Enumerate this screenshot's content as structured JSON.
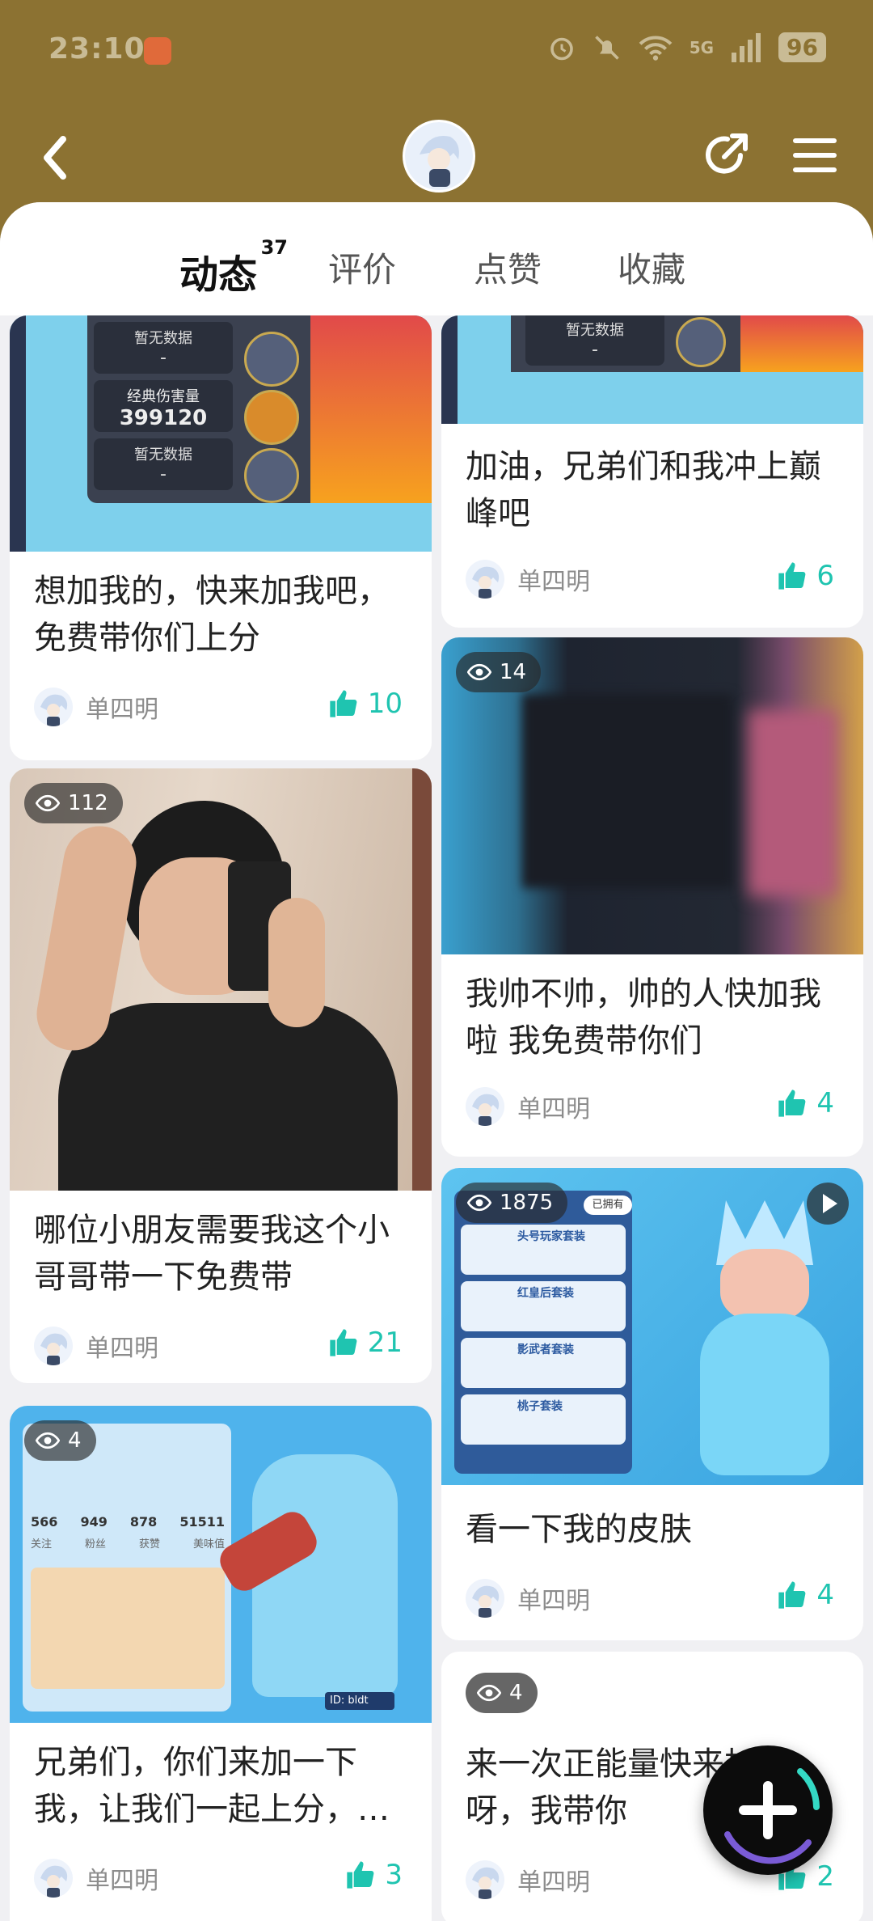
{
  "status_bar": {
    "time": "23:10",
    "battery": "96",
    "network": "5G"
  },
  "tabs": [
    {
      "label": "动态",
      "badge": "37",
      "active": true
    },
    {
      "label": "评价",
      "active": false
    },
    {
      "label": "点赞",
      "active": false
    },
    {
      "label": "收藏",
      "active": false
    }
  ],
  "colors": {
    "header_bg": "#8c7232",
    "accent": "#34d9c4",
    "like": "#1fc4b0"
  },
  "game_stats": [
    {
      "label": "暂无数据",
      "value": "-"
    },
    {
      "label": "经典伤害量",
      "value": "399120"
    },
    {
      "label": "暂无数据",
      "value": "-"
    }
  ],
  "left_cards": [
    {
      "title": "想加我的，快来加我吧，免费带你们上分",
      "author": "单四明",
      "likes": "10"
    },
    {
      "views": "112",
      "title": "哪位小朋友需要我这个小哥哥带一下免费带",
      "author": "单四明",
      "likes": "21"
    },
    {
      "views": "4",
      "title": "兄弟们，你们来加一下我，让我们一起上分，…",
      "author": "单四明",
      "likes": "3",
      "profile_stats": [
        "566",
        "949",
        "878",
        "51511"
      ],
      "profile_labels": [
        "关注",
        "粉丝",
        "获赞",
        "美味值"
      ],
      "profile_id": "ID: bldt"
    }
  ],
  "right_cards": [
    {
      "stat_label": "暂无数据",
      "stat_value": "-",
      "title": "加油，兄弟们和我冲上巅峰吧",
      "author": "单四明",
      "likes": "6"
    },
    {
      "views": "14",
      "title": "我帅不帅，帅的人快加我啦 我免费带你们",
      "author": "单四明",
      "likes": "4"
    },
    {
      "views": "1875",
      "owned": "已拥有",
      "title": "看一下我的皮肤",
      "author": "单四明",
      "likes": "4",
      "skins": [
        "头号玩家套装",
        "红皇后套装",
        "影武者套装",
        "桃子套装"
      ]
    },
    {
      "views": "4",
      "title": "来一次正能量快来加我呀，我带你",
      "author": "单四明",
      "likes": "2"
    }
  ]
}
